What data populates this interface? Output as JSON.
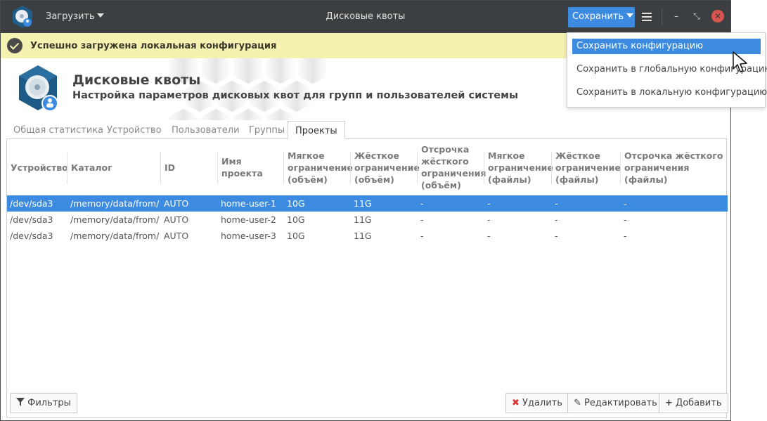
{
  "titlebar": {
    "load_menu": "Загрузить",
    "title": "Дисковые квоты",
    "save_button": "Сохранить",
    "minimize": "–",
    "restore": "⤡",
    "close": "✕"
  },
  "notice": {
    "text": "Успешно загружена локальная конфигурация"
  },
  "header": {
    "title": "Дисковые квоты",
    "subtitle": "Настройка параметров дисковых квот для групп и пользователей системы"
  },
  "tabs": [
    {
      "label": "Общая статистика"
    },
    {
      "label": "Устройство"
    },
    {
      "label": "Пользователи"
    },
    {
      "label": "Группы"
    },
    {
      "label": "Проекты",
      "active": true
    }
  ],
  "table": {
    "columns": [
      "Устройство",
      "Каталог",
      "ID",
      "Имя проекта",
      "Мягкое ограничение (объём)",
      "Жёсткое ограничение (объём)",
      "Отсрочка жёсткого ограничения (объём)",
      "Мягкое ограничение (файлы)",
      "Жёсткое ограничение (файлы)",
      "Отсрочка жёсткого ограничения (файлы)"
    ],
    "rows": [
      [
        "/dev/sda3",
        "/memory/data/from/",
        "AUTO",
        "home-user-1",
        "10G",
        "11G",
        "-",
        "-",
        "-",
        "-"
      ],
      [
        "/dev/sda3",
        "/memory/data/from/",
        "AUTO",
        "home-user-2",
        "10G",
        "11G",
        "-",
        "-",
        "-",
        "-"
      ],
      [
        "/dev/sda3",
        "/memory/data/from/",
        "AUTO",
        "home-user-3",
        "10G",
        "11G",
        "-",
        "-",
        "-",
        "-"
      ]
    ],
    "selected_row": 0
  },
  "buttons": {
    "filters": "Фильтры",
    "delete": "Удалить",
    "edit": "Редактировать",
    "add": "Добавить"
  },
  "dropdown": {
    "items": [
      "Сохранить конфигурацию",
      "Сохранить в глобальную конфигурацию",
      "Сохранить в локальную конфигурацию"
    ],
    "highlighted": 0
  },
  "colors": {
    "accent": "#3d8be0",
    "titlebar": "#3c3f41",
    "notice_bg": "#f5f1b0",
    "close": "#d9534f",
    "delete_icon": "#d9302c"
  }
}
